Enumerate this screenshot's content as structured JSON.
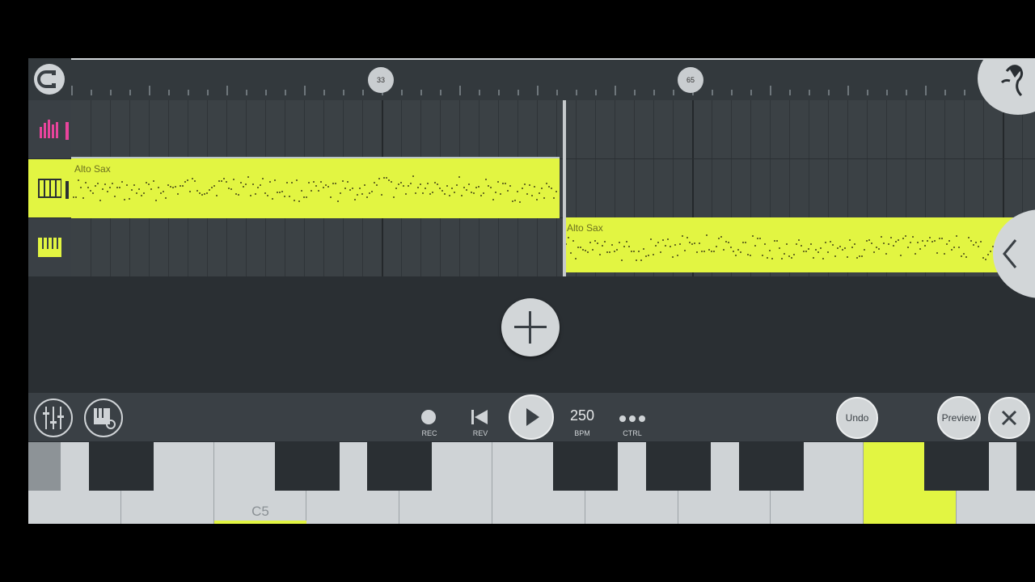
{
  "timeline": {
    "markers": [
      "33",
      "65"
    ]
  },
  "clips": [
    {
      "title": "Alto Sax"
    },
    {
      "title": "Alto Sax"
    }
  ],
  "toolbar": {
    "rec_label": "REC",
    "rev_label": "REV",
    "bpm_value": "250",
    "bpm_label": "BPM",
    "ctrl_label": "CTRL",
    "undo_label": "Undo",
    "preview_label": "Preview"
  },
  "keyboard": {
    "c5_label": "C5"
  },
  "colors": {
    "accent": "#e2f542",
    "panel": "#2a2f33",
    "pink_icon": "#e8449c"
  }
}
